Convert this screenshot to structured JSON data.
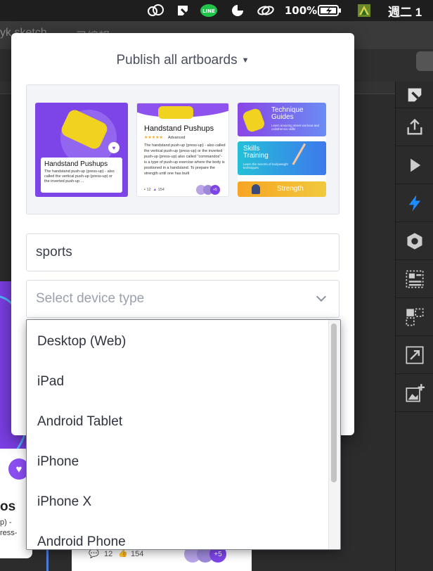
{
  "menubar": {
    "battery_percent": "100%",
    "clock": "週二 1"
  },
  "background_app": {
    "title": "yk sketch",
    "subtitle": "已編輯"
  },
  "background_card": {
    "title": "os",
    "text_line1": "p) -",
    "text_line2": "ress-",
    "comment_count": "12",
    "like_count": "154",
    "more_avatars": "+5"
  },
  "sidebar_right": {
    "items": [
      "craft-icon",
      "upload-icon",
      "play-icon",
      "bolt-icon",
      "hexagon-icon",
      "list-layout-icon",
      "grid-icon",
      "resize-icon",
      "add-image-icon"
    ]
  },
  "popup": {
    "title": "Publish all artboards",
    "artboards": {
      "a1": {
        "title": "Handstand Pushups",
        "text": "The handstand push-up (press-up) - also called the vertical push-up (press-up) or the inverted push-up ..."
      },
      "a2": {
        "title": "Handstand Pushups",
        "rating": "★★★★★",
        "level": "Advanced",
        "text": "The handstand push-up (press-up) - also called the vertical push-up (press-up) or the inverted push-up (press-up) also called \"commandos\"- is a type of push-up exercise where the body is positioned in a handstand.\nTo prepare the strength until one has built",
        "comments": "12",
        "likes": "154",
        "more": "+5"
      },
      "a3": {
        "tile1_title": "Technique Guides",
        "tile1_sub": "Learn amazing street workout and calisthenics skills",
        "tile2_title": "Skills Training",
        "tile2_sub": "Learn the secrets of bodyweight techniques",
        "tile3_title": "Strength"
      }
    },
    "tags_value": "sports",
    "device_select": {
      "placeholder": "Select device type",
      "options": [
        "Desktop (Web)",
        "iPad",
        "Android Tablet",
        "iPhone",
        "iPhone X",
        "Android Phone"
      ]
    }
  },
  "colors": {
    "accent_purple": "#7d45e8",
    "sidebar_active": "#1e8cff"
  }
}
